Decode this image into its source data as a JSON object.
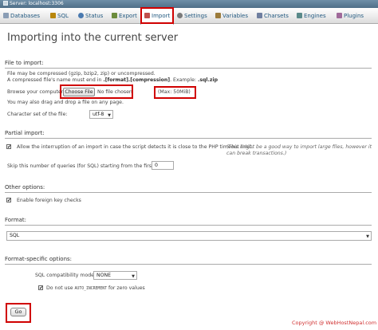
{
  "breadcrumb": {
    "server": "Server: localhost:3306"
  },
  "tabs": [
    {
      "label": "Databases",
      "icon": "database-icon"
    },
    {
      "label": "SQL",
      "icon": "sql-icon"
    },
    {
      "label": "Status",
      "icon": "status-icon"
    },
    {
      "label": "Export",
      "icon": "export-icon"
    },
    {
      "label": "Import",
      "icon": "import-icon"
    },
    {
      "label": "Settings",
      "icon": "settings-icon"
    },
    {
      "label": "Variables",
      "icon": "variables-icon"
    },
    {
      "label": "Charsets",
      "icon": "charsets-icon"
    },
    {
      "label": "Engines",
      "icon": "engines-icon"
    },
    {
      "label": "Plugins",
      "icon": "plugins-icon"
    }
  ],
  "colors": {
    "link": "#235a81",
    "highlight": "#d00000",
    "copyright": "#d03030"
  },
  "title": "Importing into the current server",
  "file_section": {
    "legend": "File to import:",
    "line1": "File may be compressed (gzip, bzip2, zip) or uncompressed.",
    "line2_prefix": "A compressed file's name must end in ",
    "line2_bold": ".[format].[compression]",
    "line2_mid": ". Example: ",
    "line2_example": ".sql.zip",
    "browse_label": "Browse your computer:",
    "choose_file_button": "Choose File",
    "no_file": "No file chosen",
    "max_size": "(Max: 50MiB)",
    "drag_drop": "You may also drag and drop a file on any page.",
    "charset_label": "Character set of the file:",
    "charset_value": "utf-8"
  },
  "partial_section": {
    "legend": "Partial import:",
    "allow_interrupt_label": "Allow the interruption of an import in case the script detects it is close to the PHP timeout limit.",
    "allow_interrupt_hint": "(This might be a good way to import large files, however it can break transactions.)",
    "allow_interrupt_checked": "✔",
    "skip_label": "Skip this number of queries (for SQL) starting from the first one:",
    "skip_value": "0"
  },
  "other_section": {
    "legend": "Other options:",
    "foreign_key_label": "Enable foreign key checks",
    "foreign_key_checked": "✔"
  },
  "format_section": {
    "legend": "Format:",
    "format_value": "SQL"
  },
  "format_specific_section": {
    "legend": "Format-specific options:",
    "compat_label": "SQL compatibility mode:",
    "compat_value": "NONE",
    "auto_inc_prefix": "Do not use ",
    "auto_inc_code": "AUTO_INCREMENT",
    "auto_inc_suffix": " for zero values",
    "auto_inc_checked": "✔"
  },
  "go_button": "Go",
  "copyright": "Copyright @ WebHostNepal.com"
}
